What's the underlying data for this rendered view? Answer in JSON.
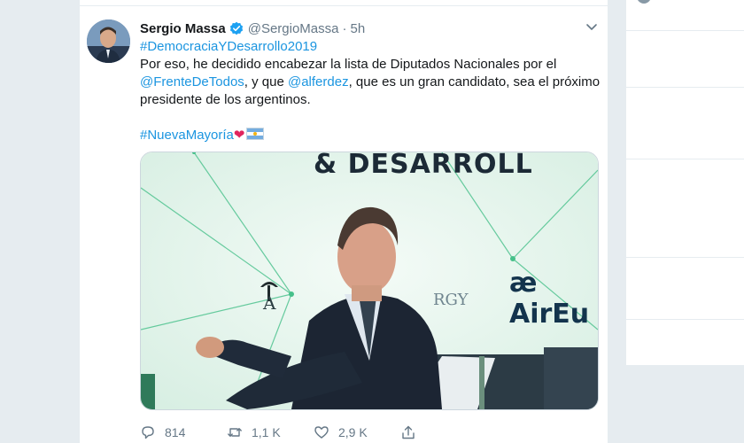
{
  "tweet": {
    "author_name": "Sergio Massa",
    "handle": "@SergioMassa",
    "separator": "·",
    "time": "5h",
    "hashtag_top": "#DemocraciaYDesarrollo2019",
    "line1": "Por eso, he decidido encabezar la lista de Diputados Nacionales por el",
    "mention1": "@FrenteDeTodos",
    "line2_mid": ", y que ",
    "mention2": "@alferdez",
    "line2_end": ", que es un gran candidato, sea el próximo",
    "line3": "presidente de los argentinos.",
    "hashtag_bottom": "#NuevaMayoría",
    "heart_emoji": "❤",
    "photo": {
      "banner": "& DESARROLL",
      "brand": "æ AirEu",
      "sponsor_text": "RGY",
      "sponsor_a": "A"
    }
  },
  "actions": {
    "reply_count": "814",
    "retweet_count": "1,1 K",
    "like_count": "2,9 K"
  },
  "colors": {
    "link": "#1b95e0",
    "verified": "#1da1f2",
    "muted": "#657786"
  },
  "icons": [
    "verified-badge-icon",
    "chevron-down-icon",
    "reply-icon",
    "retweet-icon",
    "like-icon",
    "share-icon"
  ]
}
